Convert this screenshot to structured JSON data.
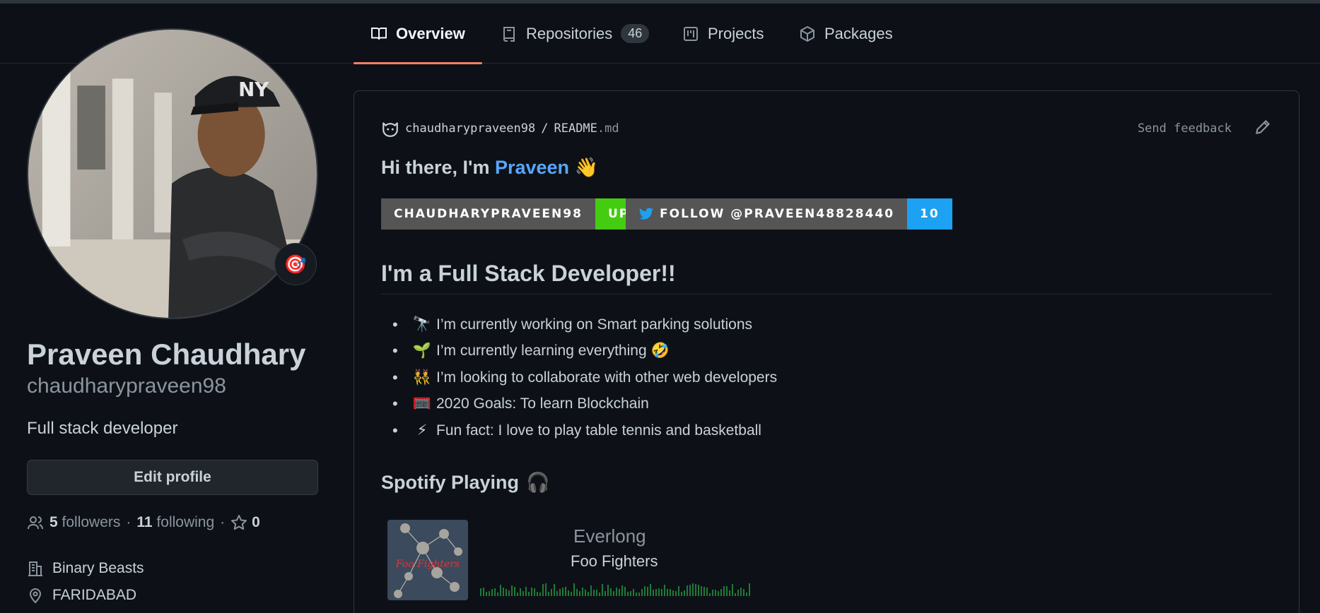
{
  "tabs": {
    "overview": "Overview",
    "repositories": "Repositories",
    "repositories_count": "46",
    "projects": "Projects",
    "packages": "Packages"
  },
  "profile": {
    "full_name": "Praveen Chaudhary",
    "username": "chaudharypraveen98",
    "bio": "Full stack developer",
    "edit_button": "Edit profile",
    "status_emoji": "🎯",
    "followers_count": "5",
    "followers_label": "followers",
    "following_count": "11",
    "following_label": "following",
    "stars_count": "0",
    "organization": "Binary Beasts",
    "location": "FARIDABAD",
    "separator": "·"
  },
  "readme": {
    "owner": "chaudharypraveen98",
    "slash": "/",
    "file_base": "README",
    "file_ext": ".md",
    "feedback": "Send feedback",
    "greeting_prefix": "Hi there, I'm ",
    "greeting_name": "Praveen",
    "greeting_emoji": "👋",
    "badge_profile_label": "CHAUDHARYPRAVEEN98",
    "badge_profile_value": "UP",
    "badge_twitter_label": "FOLLOW @PRAVEEN48828440",
    "badge_twitter_value": "10",
    "heading": "I'm a Full Stack Developer!!",
    "items": [
      {
        "emoji": "🔭",
        "text": "I’m currently working on Smart parking solutions"
      },
      {
        "emoji": "🌱",
        "text": "I’m currently learning everything 🤣"
      },
      {
        "emoji": "👯",
        "text": "I’m looking to collaborate with other web developers"
      },
      {
        "emoji": "🥅",
        "text": "2020 Goals: To learn Blockchain"
      },
      {
        "emoji": "⚡",
        "text": "Fun fact: I love to play table tennis and basketball"
      }
    ],
    "spotify_heading": "Spotify Playing",
    "spotify_emoji": "🎧",
    "song": "Everlong",
    "artist": "Foo Fighters",
    "album_text": "Foo Fighters"
  },
  "colors": {
    "accent_link": "#58a6ff",
    "tab_underline": "#f78166",
    "badge_up": "#4c1",
    "badge_twitter": "#1da1f2"
  }
}
